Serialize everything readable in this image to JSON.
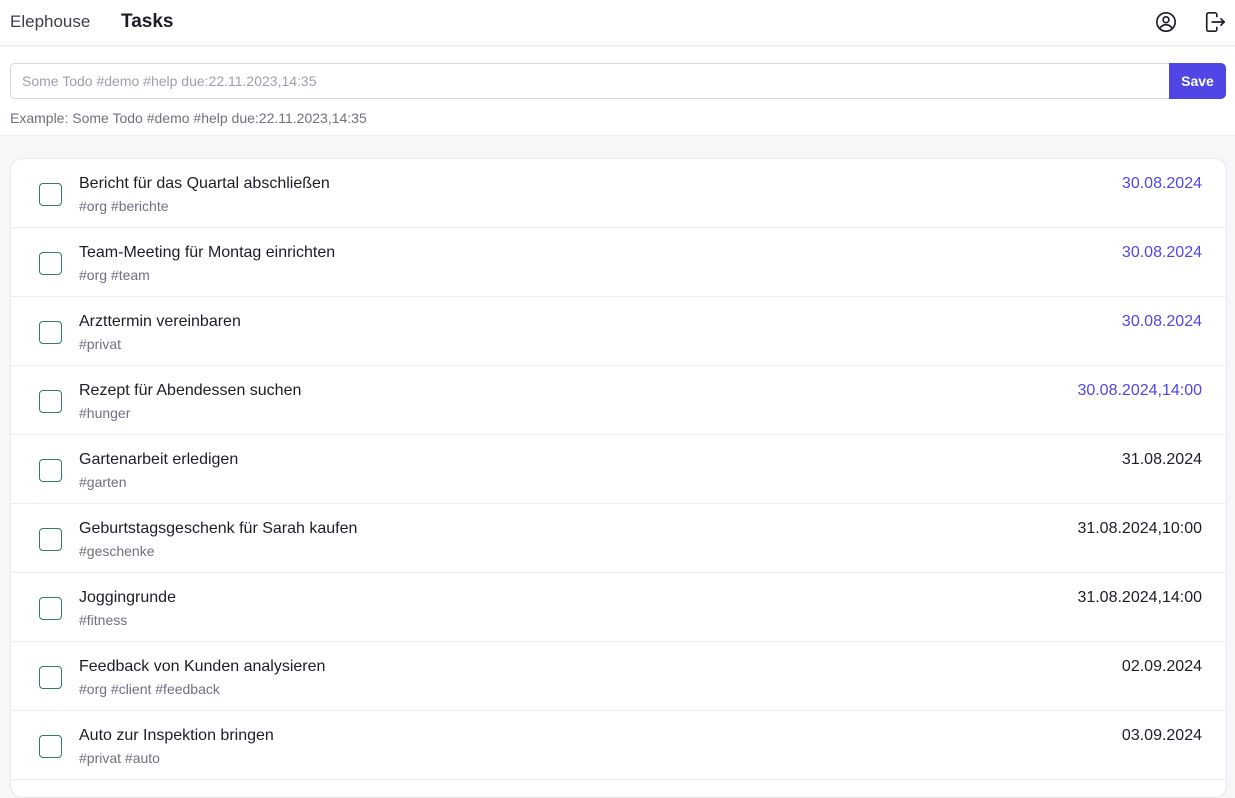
{
  "header": {
    "brand": "Elephouse",
    "title": "Tasks",
    "icons": [
      "user-circle-icon",
      "logout-icon"
    ]
  },
  "input": {
    "placeholder": "Some Todo #demo #help due:22.11.2023,14:35",
    "value": "",
    "save_label": "Save",
    "example": "Example: Some Todo #demo #help due:22.11.2023,14:35"
  },
  "colors": {
    "accent": "#4f46e5",
    "due_overdue": "#4f46e5",
    "due_normal": "#1b1e26",
    "checkbox_border": "#2f7d5a"
  },
  "tasks": [
    {
      "title": "Bericht für das Quartal abschließen",
      "tags": "#org #berichte",
      "due": "30.08.2024",
      "highlight": true
    },
    {
      "title": "Team-Meeting für Montag einrichten",
      "tags": "#org #team",
      "due": "30.08.2024",
      "highlight": true
    },
    {
      "title": "Arzttermin vereinbaren",
      "tags": "#privat",
      "due": "30.08.2024",
      "highlight": true
    },
    {
      "title": "Rezept für Abendessen suchen",
      "tags": "#hunger",
      "due": "30.08.2024,14:00",
      "highlight": true
    },
    {
      "title": "Gartenarbeit erledigen",
      "tags": "#garten",
      "due": "31.08.2024",
      "highlight": false
    },
    {
      "title": "Geburtstagsgeschenk für Sarah kaufen",
      "tags": "#geschenke",
      "due": "31.08.2024,10:00",
      "highlight": false
    },
    {
      "title": "Joggingrunde",
      "tags": "#fitness",
      "due": "31.08.2024,14:00",
      "highlight": false
    },
    {
      "title": "Feedback von Kunden analysieren",
      "tags": "#org #client #feedback",
      "due": "02.09.2024",
      "highlight": false
    },
    {
      "title": "Auto zur Inspektion bringen",
      "tags": "#privat #auto",
      "due": "03.09.2024",
      "highlight": false
    }
  ]
}
